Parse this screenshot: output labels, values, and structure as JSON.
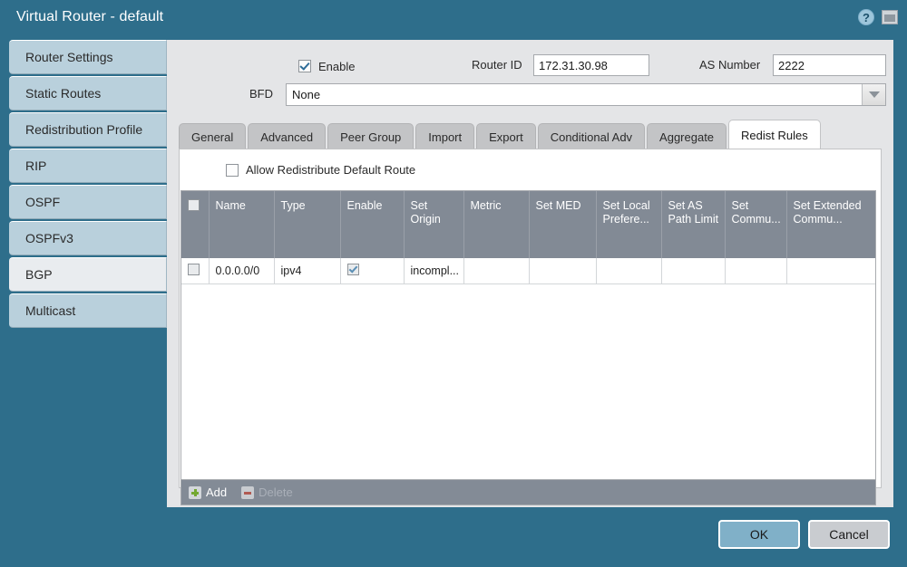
{
  "window": {
    "title": "Virtual Router - default",
    "help_icon": "help-circle-icon",
    "restore_icon": "window-restore-icon",
    "accent_color": "#2e6e8b"
  },
  "sidebar": {
    "items": [
      {
        "label": "Router Settings",
        "active": false
      },
      {
        "label": "Static Routes",
        "active": false
      },
      {
        "label": "Redistribution Profile",
        "active": false
      },
      {
        "label": "RIP",
        "active": false
      },
      {
        "label": "OSPF",
        "active": false
      },
      {
        "label": "OSPFv3",
        "active": false
      },
      {
        "label": "BGP",
        "active": true
      },
      {
        "label": "Multicast",
        "active": false
      }
    ]
  },
  "form": {
    "enable": {
      "label": "Enable",
      "checked": true
    },
    "router_id": {
      "label": "Router ID",
      "value": "172.31.30.98"
    },
    "as_number": {
      "label": "AS Number",
      "value": "2222"
    },
    "bfd": {
      "label": "BFD",
      "value": "None",
      "caret_icon": "chevron-down-icon"
    }
  },
  "tabs": [
    {
      "label": "General",
      "active": false
    },
    {
      "label": "Advanced",
      "active": false
    },
    {
      "label": "Peer Group",
      "active": false
    },
    {
      "label": "Import",
      "active": false
    },
    {
      "label": "Export",
      "active": false
    },
    {
      "label": "Conditional Adv",
      "active": false
    },
    {
      "label": "Aggregate",
      "active": false
    },
    {
      "label": "Redist Rules",
      "active": true
    }
  ],
  "redist": {
    "allow_default_route": {
      "label": "Allow Redistribute Default Route",
      "checked": false
    },
    "columns": [
      "",
      "Name",
      "Type",
      "Enable",
      "Set Origin",
      "Metric",
      "Set MED",
      "Set Local Prefere...",
      "Set AS Path Limit",
      "Set Commu...",
      "Set Extended Commu..."
    ],
    "rows": [
      {
        "selected": false,
        "name": "0.0.0.0/0",
        "type": "ipv4",
        "enable": true,
        "set_origin": "incompl...",
        "metric": "",
        "set_med": "",
        "set_local_preference": "",
        "set_as_path_limit": "",
        "set_community": "",
        "set_extended_community": ""
      }
    ],
    "toolbar": {
      "add_label": "Add",
      "add_icon": "plus-icon",
      "delete_label": "Delete",
      "delete_icon": "minus-icon",
      "delete_disabled": true
    }
  },
  "footer": {
    "ok_label": "OK",
    "cancel_label": "Cancel"
  }
}
